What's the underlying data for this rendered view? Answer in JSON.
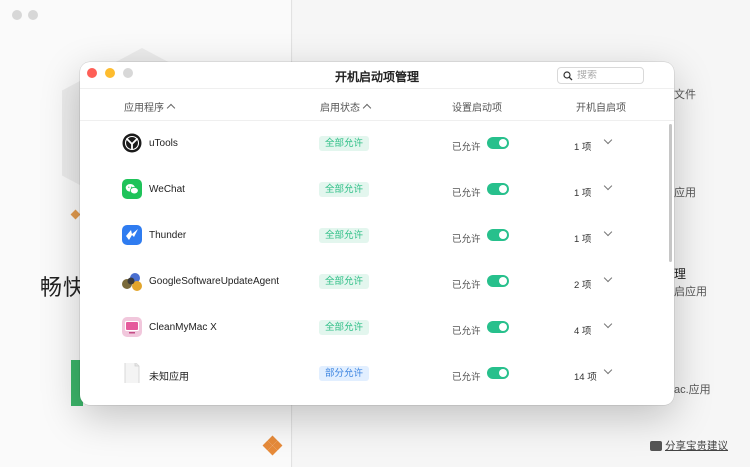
{
  "background": {
    "big_title": "畅快",
    "side_texts": [
      "文件",
      "应用",
      "理",
      "启应用",
      "ac.应用"
    ],
    "feedback": "分享宝贵建议"
  },
  "dialog": {
    "title": "开机启动项管理",
    "search": {
      "placeholder": "搜索",
      "value": ""
    },
    "columns": {
      "app": "应用程序",
      "status": "启用状态",
      "setting": "设置启动项",
      "items": "开机自启项"
    },
    "rows": [
      {
        "name": "uTools",
        "icon": "utools-icon",
        "status": "全部允许",
        "status_type": "all",
        "allow": "已允许",
        "enabled": true,
        "count": "1 项"
      },
      {
        "name": "WeChat",
        "icon": "wechat-icon",
        "status": "全部允许",
        "status_type": "all",
        "allow": "已允许",
        "enabled": true,
        "count": "1 项"
      },
      {
        "name": "Thunder",
        "icon": "thunder-icon",
        "status": "全部允许",
        "status_type": "all",
        "allow": "已允许",
        "enabled": true,
        "count": "1 项"
      },
      {
        "name": "GoogleSoftwareUpdateAgent",
        "icon": "google-update-icon",
        "status": "全部允许",
        "status_type": "all",
        "allow": "已允许",
        "enabled": true,
        "count": "2 项"
      },
      {
        "name": "CleanMyMac X",
        "icon": "cleanmymac-icon",
        "status": "全部允许",
        "status_type": "all",
        "allow": "已允许",
        "enabled": true,
        "count": "4 项"
      },
      {
        "name": "未知应用",
        "icon": "unknown-app-icon",
        "status": "部分允许",
        "status_type": "part",
        "allow": "已允许",
        "enabled": true,
        "count": "14 项"
      }
    ]
  },
  "colors": {
    "toggle_on": "#27c08c",
    "badge_all_bg": "#e3f6ee",
    "badge_all_text": "#2fbf87",
    "badge_part_bg": "#e2efff",
    "badge_part_text": "#3d85e0"
  }
}
